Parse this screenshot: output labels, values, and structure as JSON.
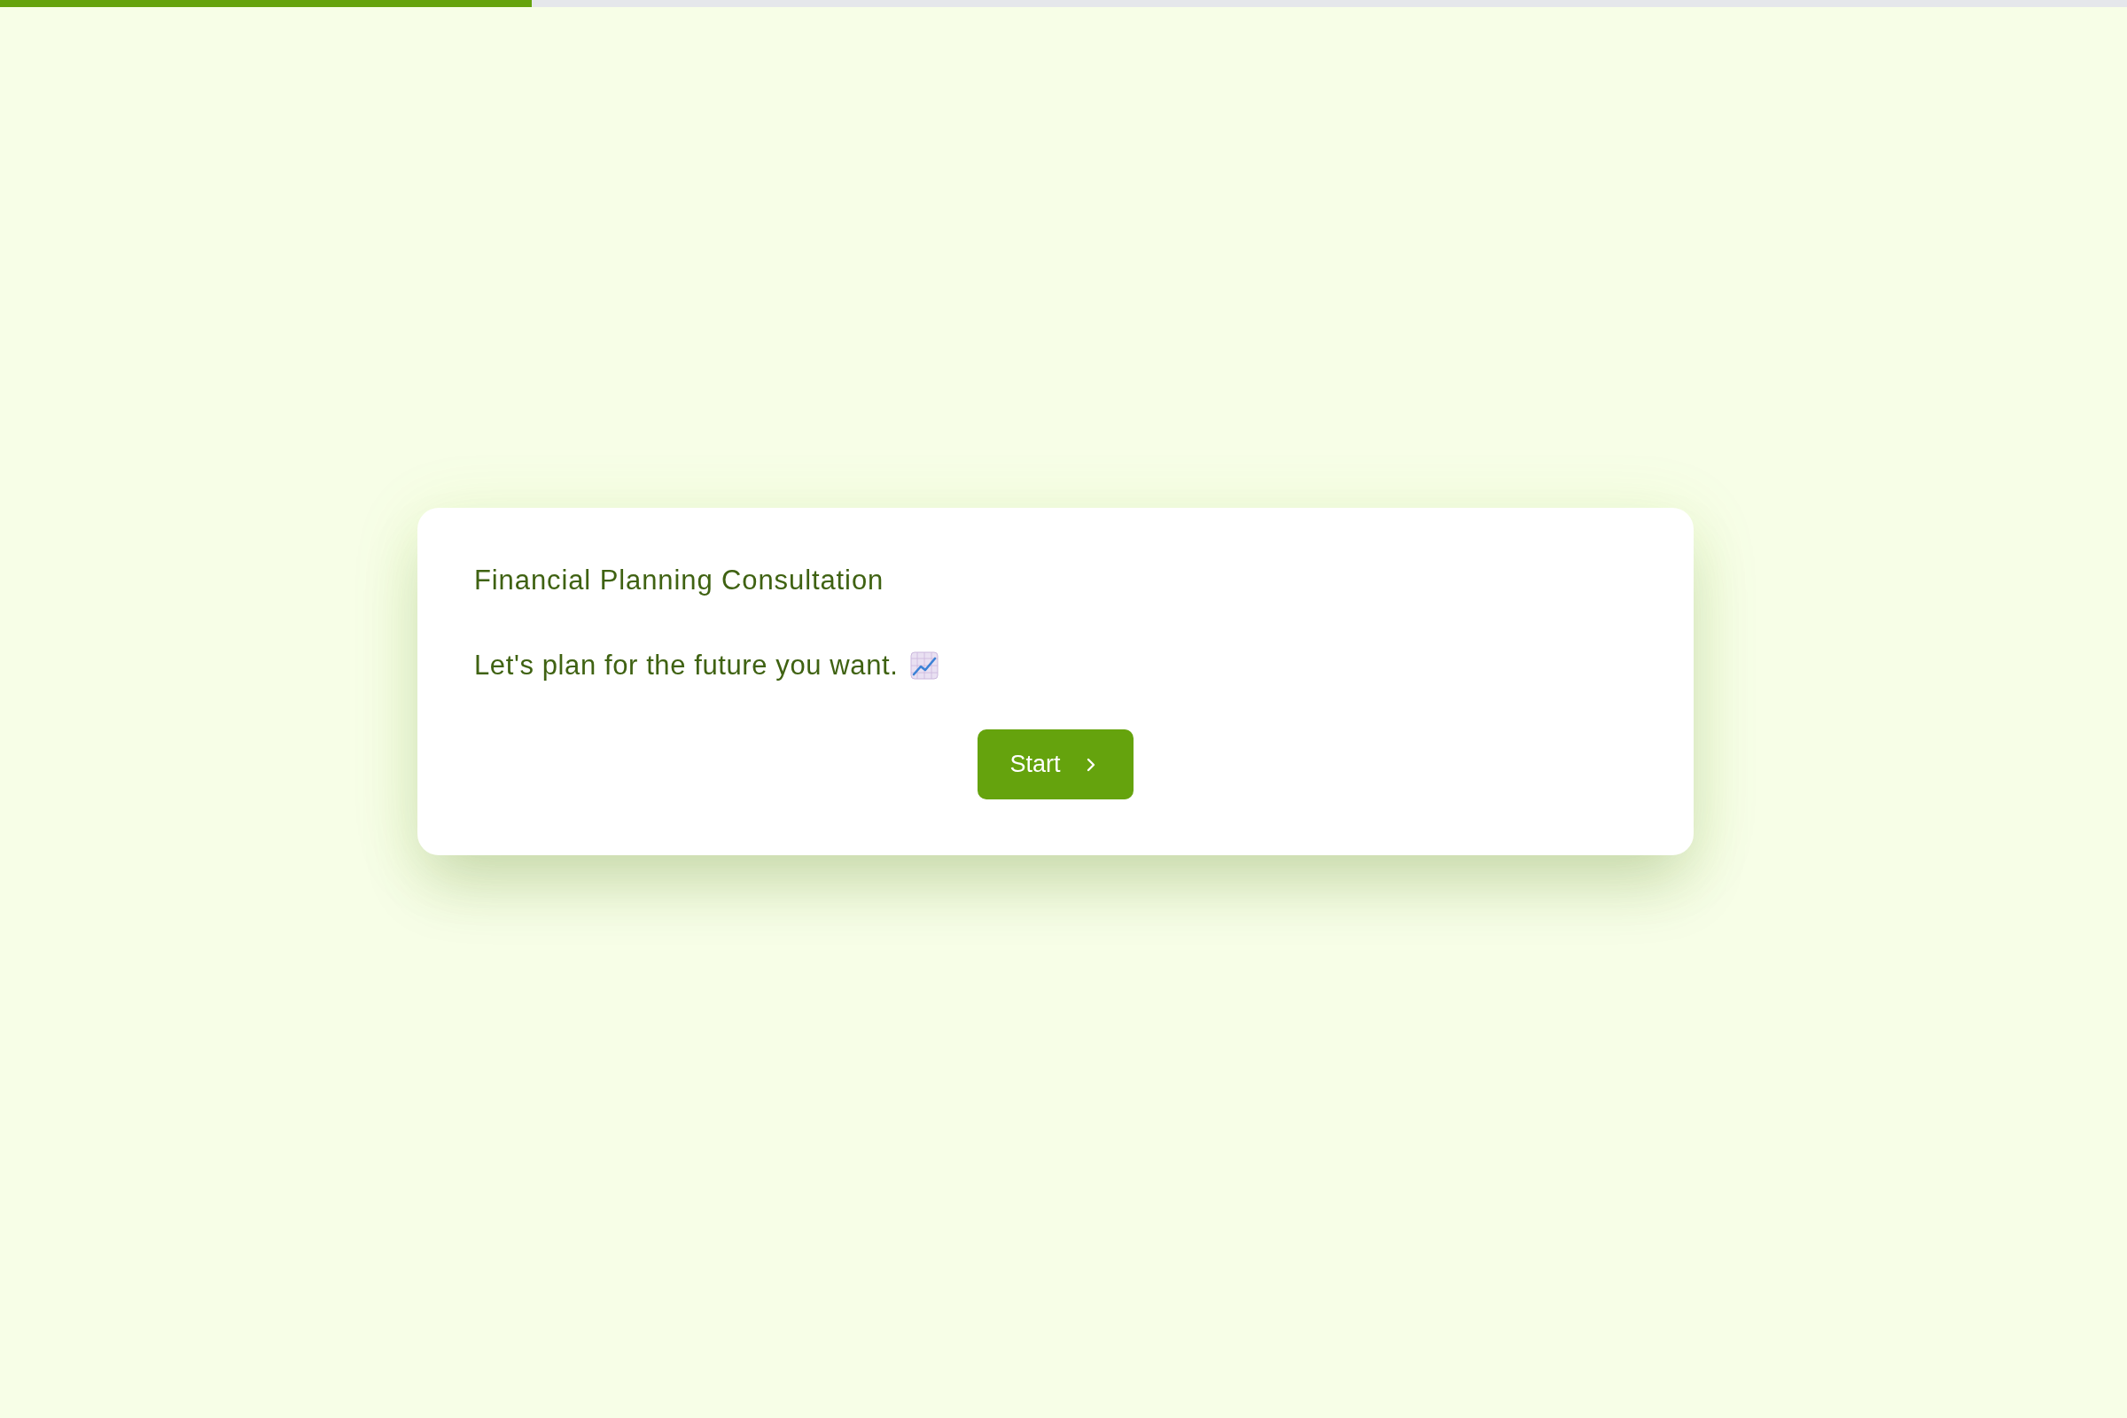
{
  "progress": {
    "level": 0.25
  },
  "card": {
    "title": "Financial Planning Consultation",
    "message": "Let's plan for the future you want.",
    "button": {
      "label": "Start"
    }
  }
}
